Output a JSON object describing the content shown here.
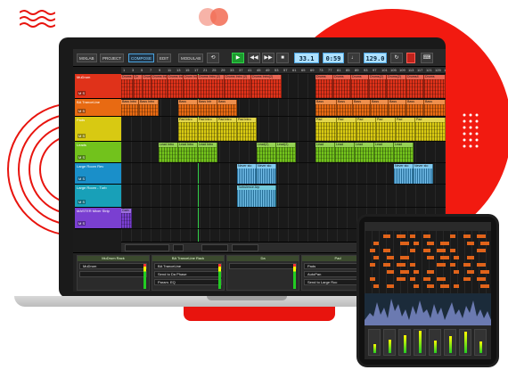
{
  "app": {
    "toolbar": {
      "modes": [
        "MIXLAB",
        "PROJECT",
        "COMPOSE",
        "EDIT",
        "MODULAB"
      ],
      "active_mode": "COMPOSE",
      "position": "33.1",
      "time": "0:59",
      "tempo": "129.0"
    },
    "ruler": [
      "1",
      "3",
      "5",
      "7",
      "9",
      "11",
      "13",
      "15",
      "17",
      "21",
      "25",
      "29",
      "33",
      "37",
      "41",
      "45",
      "49",
      "53",
      "57",
      "61",
      "65",
      "69",
      "73",
      "77",
      "81",
      "85",
      "89",
      "93",
      "97",
      "101",
      "105",
      "109",
      "113",
      "117",
      "121",
      "125",
      "129"
    ],
    "tracks": [
      {
        "name": "MuDrum",
        "color": "#e0321a",
        "ms": "M S"
      },
      {
        "name": "BA TranceLine",
        "color": "#e86a12",
        "ms": "M S"
      },
      {
        "name": "Pads",
        "color": "#d8c912",
        "ms": "M S"
      },
      {
        "name": "Leads",
        "color": "#72c21c",
        "ms": "M S"
      },
      {
        "name": "Large Room Rev",
        "color": "#1a8fc9",
        "ms": "M S"
      },
      {
        "name": "Large Room - Turb",
        "color": "#18a0b8",
        "ms": "M S"
      },
      {
        "name": "MASTER Mixer Strip",
        "color": "#7a3fd1",
        "ms": "M S"
      }
    ],
    "clips": {
      "drums": [
        {
          "label": "Drums",
          "start": 0,
          "width": 14
        },
        {
          "label": "Dr",
          "start": 14,
          "width": 10
        },
        {
          "label": "Drums",
          "start": 24,
          "width": 10
        },
        {
          "label": "Drums Intro",
          "start": 34,
          "width": 18
        },
        {
          "label": "Drums Intro",
          "start": 52,
          "width": 18
        },
        {
          "label": "Drum Intr",
          "start": 70,
          "width": 16
        },
        {
          "label": "Drums Intro (2)",
          "start": 86,
          "width": 30
        },
        {
          "label": "Drums Intro (2)",
          "start": 116,
          "width": 30
        },
        {
          "label": "Drums Intro(2)",
          "start": 146,
          "width": 34
        },
        {
          "label": "Drums",
          "start": 218,
          "width": 20
        },
        {
          "label": "Drums",
          "start": 238,
          "width": 20
        },
        {
          "label": "Drums",
          "start": 258,
          "width": 20
        },
        {
          "label": "Drums(2)",
          "start": 278,
          "width": 20
        },
        {
          "label": "Drums(2)",
          "start": 298,
          "width": 22
        },
        {
          "label": "Drums4",
          "start": 320,
          "width": 20
        },
        {
          "label": "Drums",
          "start": 340,
          "width": 24
        }
      ],
      "bass": [
        {
          "label": "Bass Intro",
          "start": 0,
          "width": 20
        },
        {
          "label": "Bass Intro",
          "start": 20,
          "width": 22
        },
        {
          "label": "Bass",
          "start": 64,
          "width": 22
        },
        {
          "label": "Bass Intr",
          "start": 86,
          "width": 22
        },
        {
          "label": "Bass",
          "start": 108,
          "width": 22
        },
        {
          "label": "Bass",
          "start": 218,
          "width": 24
        },
        {
          "label": "Bass",
          "start": 242,
          "width": 18
        },
        {
          "label": "Bass",
          "start": 260,
          "width": 20
        },
        {
          "label": "Bass",
          "start": 280,
          "width": 20
        },
        {
          "label": "Bass",
          "start": 300,
          "width": 20
        },
        {
          "label": "Bass",
          "start": 320,
          "width": 20
        },
        {
          "label": "Bass",
          "start": 340,
          "width": 24
        }
      ],
      "pads": [
        {
          "label": "Pad Intro",
          "start": 64,
          "width": 22
        },
        {
          "label": "Pad Intro",
          "start": 86,
          "width": 22
        },
        {
          "label": "Pad Intro",
          "start": 108,
          "width": 22
        },
        {
          "label": "Pad Intro",
          "start": 130,
          "width": 22
        },
        {
          "label": "Pad",
          "start": 218,
          "width": 24
        },
        {
          "label": "Pad",
          "start": 242,
          "width": 22
        },
        {
          "label": "Pad",
          "start": 264,
          "width": 22
        },
        {
          "label": "Pad",
          "start": 286,
          "width": 22
        },
        {
          "label": "Pad",
          "start": 308,
          "width": 22
        },
        {
          "label": "Pad",
          "start": 330,
          "width": 34
        }
      ],
      "leads": [
        {
          "label": "Lead Intro",
          "start": 42,
          "width": 22
        },
        {
          "label": "Lead Intro",
          "start": 64,
          "width": 22
        },
        {
          "label": "Lead Intro",
          "start": 86,
          "width": 22
        },
        {
          "label": "Lead(2)",
          "start": 152,
          "width": 22
        },
        {
          "label": "Lead(2)",
          "start": 174,
          "width": 22
        },
        {
          "label": "Lead",
          "start": 218,
          "width": 22
        },
        {
          "label": "Lead",
          "start": 240,
          "width": 22
        },
        {
          "label": "Lead",
          "start": 262,
          "width": 22
        },
        {
          "label": "Lead",
          "start": 284,
          "width": 22
        },
        {
          "label": "Lead",
          "start": 306,
          "width": 22
        }
      ],
      "audio1": [
        {
          "label": "Never sto",
          "start": 130,
          "width": 22
        },
        {
          "label": "Never sto",
          "start": 152,
          "width": 22
        },
        {
          "label": "Never sto",
          "start": 306,
          "width": 22
        },
        {
          "label": "Never sto",
          "start": 328,
          "width": 22
        }
      ],
      "audio2": [
        {
          "label": "Turbulence Arp",
          "start": 130,
          "width": 44
        }
      ],
      "master": [
        {
          "label": "Gain",
          "start": 0,
          "width": 12
        }
      ]
    },
    "racks": [
      {
        "title": "MuDrum Rack",
        "rows": [
          "MuDrum",
          ""
        ]
      },
      {
        "title": "BA TranceLine Rack",
        "rows": [
          "BA TranceLine",
          "Send to Da Phase",
          "Param. EQ"
        ]
      },
      {
        "title": "Da",
        "rows": [
          ""
        ]
      },
      {
        "title": "Pad",
        "rows": [
          "Pads",
          "AutoPan",
          "Send to Large Roc"
        ]
      },
      {
        "title": "Leads Rack",
        "rows": [
          "Leads",
          "HiBulba",
          ""
        ]
      }
    ]
  }
}
